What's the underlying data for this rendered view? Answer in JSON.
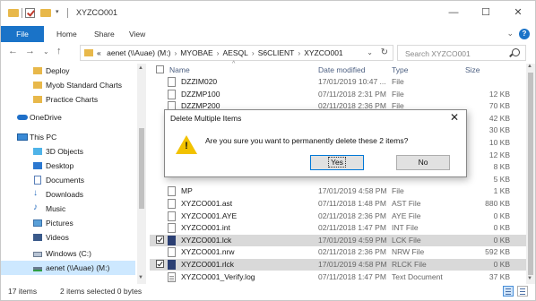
{
  "window": {
    "title": "XYZCO001",
    "minimize": "—",
    "maximize": "☐",
    "close": "✕"
  },
  "ribbon": {
    "tabs": [
      "File",
      "Home",
      "Share",
      "View"
    ]
  },
  "address": {
    "prefix": "«",
    "segments": [
      "aenet (\\\\Auae) (M:)",
      "MYOBAE",
      "AESQL",
      "S6CLIENT",
      "XYZCO001"
    ],
    "search_placeholder": "Search XYZCO001"
  },
  "nav_pane": {
    "items": [
      {
        "label": "Deploy",
        "icon": "folder-icon"
      },
      {
        "label": "Myob Standard Charts",
        "icon": "folder-icon"
      },
      {
        "label": "Practice Charts",
        "icon": "folder-icon"
      },
      {
        "label": "OneDrive",
        "icon": "onedrive-icon"
      },
      {
        "label": "This PC",
        "icon": "computer-icon"
      },
      {
        "label": "3D Objects",
        "icon": "3d-objects-icon"
      },
      {
        "label": "Desktop",
        "icon": "desktop-icon"
      },
      {
        "label": "Documents",
        "icon": "documents-icon"
      },
      {
        "label": "Downloads",
        "icon": "downloads-icon"
      },
      {
        "label": "Music",
        "icon": "music-icon"
      },
      {
        "label": "Pictures",
        "icon": "pictures-icon"
      },
      {
        "label": "Videos",
        "icon": "videos-icon"
      },
      {
        "label": "Windows (C:)",
        "icon": "drive-icon"
      },
      {
        "label": "aenet (\\\\Auae) (M:)",
        "icon": "network-drive-icon"
      }
    ]
  },
  "file_list": {
    "columns": [
      "Name",
      "Date modified",
      "Type",
      "Size"
    ],
    "rows": [
      {
        "name": "DZZIM020",
        "date": "17/01/2019 10:47 ...",
        "type": "File",
        "size": "",
        "selected": false
      },
      {
        "name": "DZZMP100",
        "date": "07/11/2018 2:31 PM",
        "type": "File",
        "size": "12 KB",
        "selected": false
      },
      {
        "name": "DZZMP200",
        "date": "02/11/2018 2:36 PM",
        "type": "File",
        "size": "70 KB",
        "selected": false
      },
      {
        "name": "",
        "date": "",
        "type": "",
        "size": "42 KB",
        "selected": false
      },
      {
        "name": "",
        "date": "",
        "type": "",
        "size": "30 KB",
        "selected": false
      },
      {
        "name": "",
        "date": "",
        "type": "",
        "size": "10 KB",
        "selected": false
      },
      {
        "name": "",
        "date": "",
        "type": "",
        "size": "12 KB",
        "selected": false
      },
      {
        "name": "",
        "date": "",
        "type": "",
        "size": "8 KB",
        "selected": false
      },
      {
        "name": "",
        "date": "",
        "type": "",
        "size": "5 KB",
        "selected": false
      },
      {
        "name": "MP",
        "date": "17/01/2019 4:58 PM",
        "type": "File",
        "size": "1 KB",
        "selected": false
      },
      {
        "name": "XYZCO001.ast",
        "date": "07/11/2018 1:48 PM",
        "type": "AST File",
        "size": "880 KB",
        "selected": false
      },
      {
        "name": "XYZCO001.AYE",
        "date": "02/11/2018 2:36 PM",
        "type": "AYE File",
        "size": "0 KB",
        "selected": false
      },
      {
        "name": "XYZCO001.int",
        "date": "02/11/2018 1:47 PM",
        "type": "INT File",
        "size": "0 KB",
        "selected": false
      },
      {
        "name": "XYZCO001.lck",
        "date": "17/01/2019 4:59 PM",
        "type": "LCK File",
        "size": "0 KB",
        "selected": true
      },
      {
        "name": "XYZCO001.nrw",
        "date": "02/11/2018 2:36 PM",
        "type": "NRW File",
        "size": "592 KB",
        "selected": false
      },
      {
        "name": "XYZCO001.rlck",
        "date": "17/01/2019 4:58 PM",
        "type": "RLCK File",
        "size": "0 KB",
        "selected": true
      },
      {
        "name": "XYZCO001_Verify.log",
        "date": "07/11/2018 1:47 PM",
        "type": "Text Document",
        "size": "37 KB",
        "selected": false
      }
    ]
  },
  "status": {
    "items_count": "17 items",
    "selection": "2 items selected  0 bytes"
  },
  "dialog": {
    "title": "Delete Multiple Items",
    "message": "Are you sure you want to permanently delete these 2 items?",
    "yes_label": "Yes",
    "no_label": "No"
  },
  "colors": {
    "accent": "#1a73c8",
    "folder": "#e8b84a",
    "warning": "#f2c200",
    "selected_row": "#d9d9d9"
  }
}
